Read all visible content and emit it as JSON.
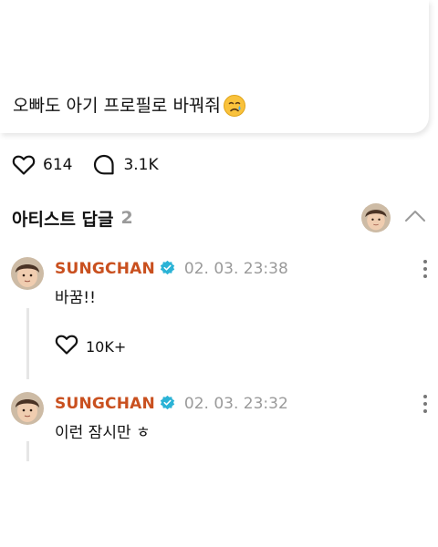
{
  "post": {
    "text": "오빠도 아기 프로필로 바꿔줘",
    "emoji": "crying-face"
  },
  "reactions": {
    "likes": "614",
    "comments": "3.1K"
  },
  "artist_replies": {
    "title": "아티스트 답글",
    "count": "2"
  },
  "comments": [
    {
      "author": "SUNGCHAN",
      "timestamp": "02. 03. 23:38",
      "text": "바꿈!!",
      "likes": "10K+"
    },
    {
      "author": "SUNGCHAN",
      "timestamp": "02. 03. 23:32",
      "text": "이런 잠시만 ㅎ"
    }
  ],
  "colors": {
    "author": "#c9501f",
    "verified": "#2bb3d6",
    "muted": "#9a9a9a"
  }
}
